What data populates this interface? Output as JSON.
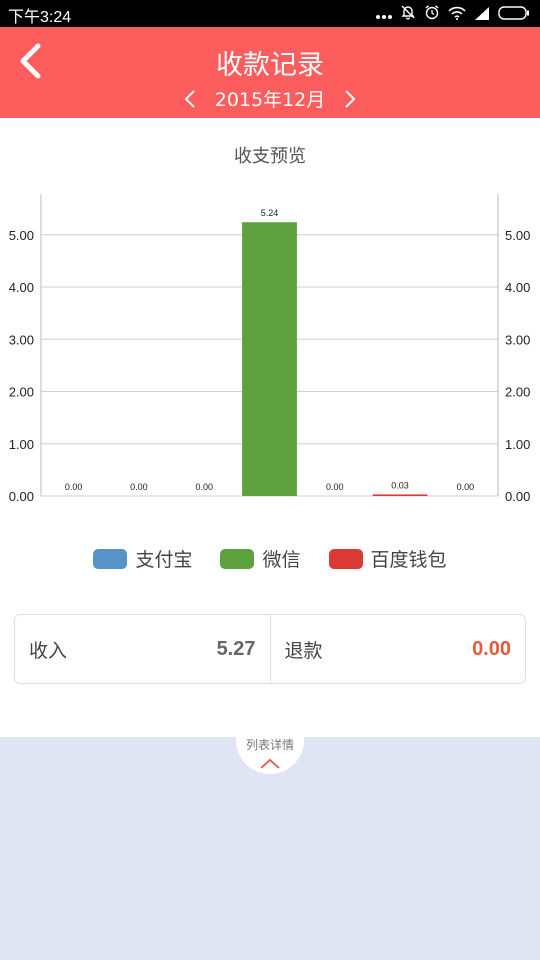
{
  "status_bar": {
    "time": "下午3:24",
    "icons": [
      "more-dots-icon",
      "notification-off-icon",
      "alarm-icon",
      "wifi-icon",
      "signal-icon",
      "battery-icon"
    ]
  },
  "header": {
    "title": "收款记录",
    "month": "2015年12月",
    "background": "#fd5d5d",
    "back_icon": "chevron-left-icon",
    "prev_icon": "chevron-left-icon",
    "next_icon": "chevron-right-icon"
  },
  "chart_title": "收支预览",
  "chart_data": {
    "type": "bar",
    "categories": [
      "",
      "",
      "",
      "",
      "",
      "",
      ""
    ],
    "values": [
      0.0,
      0.0,
      0.0,
      5.24,
      0.0,
      0.03,
      0.0
    ],
    "value_labels": [
      "0.00",
      "0.00",
      "0.00",
      "5.24",
      "0.00",
      "0.03",
      "0.00"
    ],
    "bar_colors": [
      "#5b9bd5",
      "#5b9bd5",
      "#5b9bd5",
      "#5da23f",
      "#5da23f",
      "#db3a34",
      "#db3a34"
    ],
    "yticks": [
      "0.00",
      "1.00",
      "2.00",
      "3.00",
      "4.00",
      "5.00"
    ],
    "ylim": [
      0,
      5.78
    ],
    "grid": true,
    "dual_axis": true
  },
  "legend": [
    {
      "label": "支付宝",
      "color": "#5593c8"
    },
    {
      "label": "微信",
      "color": "#5da23f"
    },
    {
      "label": "百度钱包",
      "color": "#db3a34"
    }
  ],
  "summary": {
    "income_label": "收入",
    "income_value": "5.27",
    "income_color": "#666666",
    "refund_label": "退款",
    "refund_value": "0.00",
    "refund_color": "#e8583a"
  },
  "list_toggle": {
    "label": "列表详情",
    "icon": "chevron-up-icon"
  },
  "bottom_panel_color": "#e0e5f4"
}
